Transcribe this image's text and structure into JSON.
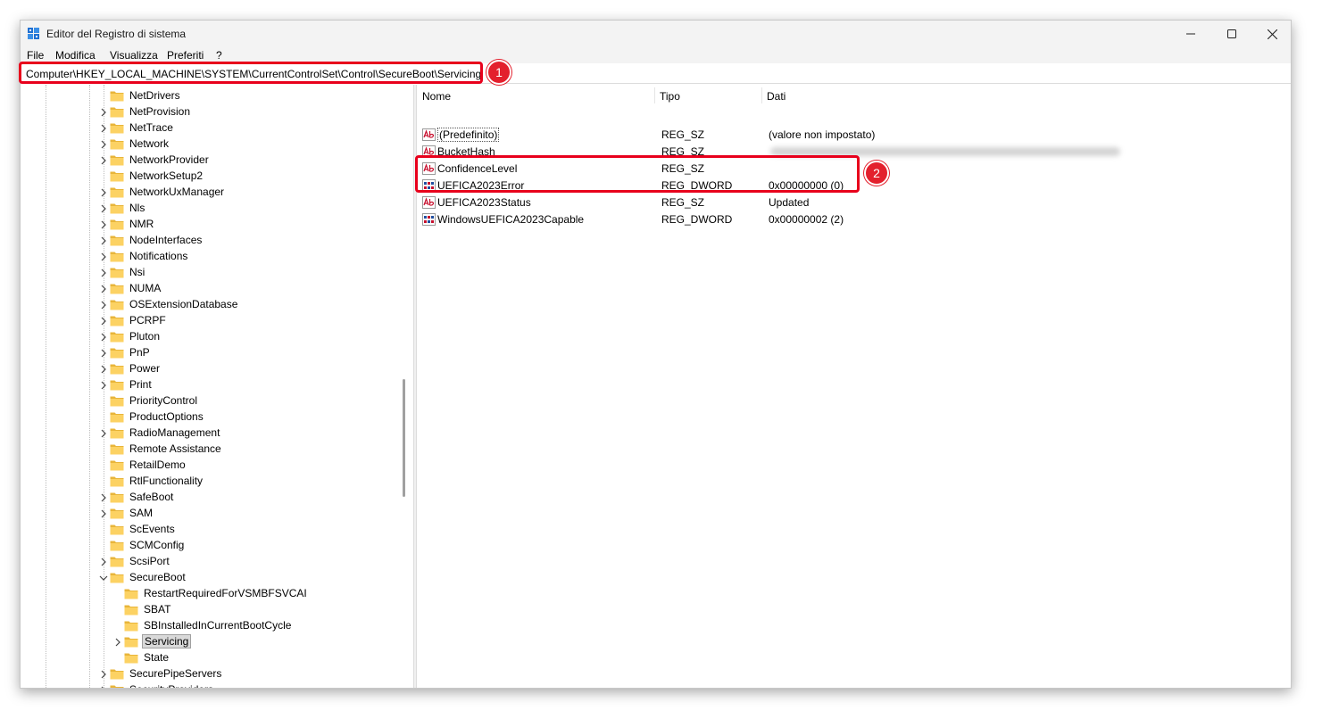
{
  "window": {
    "title": "Editor del Registro di sistema"
  },
  "menu": [
    "File",
    "Modifica",
    "Visualizza",
    "Preferiti",
    "?"
  ],
  "address": {
    "path": "Computer\\HKEY_LOCAL_MACHINE\\SYSTEM\\CurrentControlSet\\Control\\SecureBoot\\Servicing"
  },
  "annotations": {
    "badge1": "1",
    "badge2": "2",
    "color": "#e8001c"
  },
  "tree": {
    "items": [
      {
        "label": "NetDrivers",
        "level": 0,
        "expander": "none"
      },
      {
        "label": "NetProvision",
        "level": 0,
        "expander": "collapsed"
      },
      {
        "label": "NetTrace",
        "level": 0,
        "expander": "collapsed"
      },
      {
        "label": "Network",
        "level": 0,
        "expander": "collapsed"
      },
      {
        "label": "NetworkProvider",
        "level": 0,
        "expander": "collapsed"
      },
      {
        "label": "NetworkSetup2",
        "level": 0,
        "expander": "none"
      },
      {
        "label": "NetworkUxManager",
        "level": 0,
        "expander": "collapsed"
      },
      {
        "label": "Nls",
        "level": 0,
        "expander": "collapsed"
      },
      {
        "label": "NMR",
        "level": 0,
        "expander": "collapsed"
      },
      {
        "label": "NodeInterfaces",
        "level": 0,
        "expander": "collapsed"
      },
      {
        "label": "Notifications",
        "level": 0,
        "expander": "collapsed"
      },
      {
        "label": "Nsi",
        "level": 0,
        "expander": "collapsed"
      },
      {
        "label": "NUMA",
        "level": 0,
        "expander": "collapsed"
      },
      {
        "label": "OSExtensionDatabase",
        "level": 0,
        "expander": "collapsed"
      },
      {
        "label": "PCRPF",
        "level": 0,
        "expander": "collapsed"
      },
      {
        "label": "Pluton",
        "level": 0,
        "expander": "collapsed"
      },
      {
        "label": "PnP",
        "level": 0,
        "expander": "collapsed"
      },
      {
        "label": "Power",
        "level": 0,
        "expander": "collapsed"
      },
      {
        "label": "Print",
        "level": 0,
        "expander": "collapsed"
      },
      {
        "label": "PriorityControl",
        "level": 0,
        "expander": "none"
      },
      {
        "label": "ProductOptions",
        "level": 0,
        "expander": "none"
      },
      {
        "label": "RadioManagement",
        "level": 0,
        "expander": "collapsed"
      },
      {
        "label": "Remote Assistance",
        "level": 0,
        "expander": "none"
      },
      {
        "label": "RetailDemo",
        "level": 0,
        "expander": "none"
      },
      {
        "label": "RtlFunctionality",
        "level": 0,
        "expander": "none"
      },
      {
        "label": "SafeBoot",
        "level": 0,
        "expander": "collapsed"
      },
      {
        "label": "SAM",
        "level": 0,
        "expander": "collapsed"
      },
      {
        "label": "ScEvents",
        "level": 0,
        "expander": "none"
      },
      {
        "label": "SCMConfig",
        "level": 0,
        "expander": "none"
      },
      {
        "label": "ScsiPort",
        "level": 0,
        "expander": "collapsed"
      },
      {
        "label": "SecureBoot",
        "level": 0,
        "expander": "expanded"
      },
      {
        "label": "RestartRequiredForVSMBFSVCAI",
        "level": 1,
        "expander": "none"
      },
      {
        "label": "SBAT",
        "level": 1,
        "expander": "none"
      },
      {
        "label": "SBInstalledInCurrentBootCycle",
        "level": 1,
        "expander": "none"
      },
      {
        "label": "Servicing",
        "level": 1,
        "expander": "collapsed",
        "selected": true
      },
      {
        "label": "State",
        "level": 1,
        "expander": "none"
      },
      {
        "label": "SecurePipeServers",
        "level": 0,
        "expander": "collapsed"
      },
      {
        "label": "SecurityProviders",
        "level": 0,
        "expander": "collapsed"
      }
    ]
  },
  "list": {
    "columns": [
      "Nome",
      "Tipo",
      "Dati"
    ],
    "rows": [
      {
        "icon": "string-value-icon",
        "name": "(Predefinito)",
        "type": "REG_SZ",
        "data": "(valore non impostato)",
        "focus": true
      },
      {
        "icon": "string-value-icon",
        "name": "BucketHash",
        "type": "REG_SZ",
        "data": "",
        "blurred": true
      },
      {
        "icon": "string-value-icon",
        "name": "ConfidenceLevel",
        "type": "REG_SZ",
        "data": ""
      },
      {
        "icon": "dword-value-icon",
        "name": "UEFICA2023Error",
        "type": "REG_DWORD",
        "data": "0x00000000 (0)"
      },
      {
        "icon": "string-value-icon",
        "name": "UEFICA2023Status",
        "type": "REG_SZ",
        "data": "Updated"
      },
      {
        "icon": "dword-value-icon",
        "name": "WindowsUEFICA2023Capable",
        "type": "REG_DWORD",
        "data": "0x00000002 (2)"
      }
    ]
  }
}
